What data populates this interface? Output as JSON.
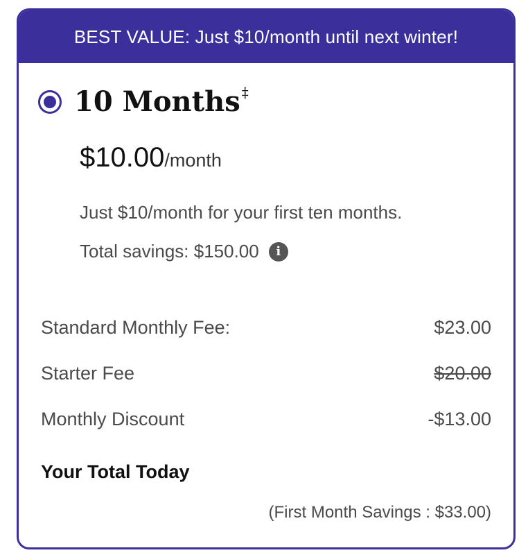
{
  "banner": {
    "text": "BEST VALUE: Just $10/month until next winter!"
  },
  "plan": {
    "selected": true,
    "title": "10 Months",
    "title_mark": "‡",
    "price": "$10.00",
    "price_unit": "/month",
    "description": "Just $10/month for your first ten months.",
    "savings_text": "Total savings: $150.00",
    "info_icon_glyph": "i"
  },
  "breakdown": {
    "standard_fee": {
      "label": "Standard Monthly Fee:",
      "value": "$23.00"
    },
    "starter_fee": {
      "label": "Starter Fee",
      "value": "$20.00",
      "struck": true
    },
    "monthly_discount": {
      "label": "Monthly Discount",
      "value": "-$13.00"
    }
  },
  "total": {
    "label": "Your Total Today",
    "first_month_savings": "(First Month Savings : $33.00)"
  },
  "colors": {
    "accent": "#3b2f9c",
    "text_dark": "#111111",
    "text_muted": "#4a4a4a"
  }
}
